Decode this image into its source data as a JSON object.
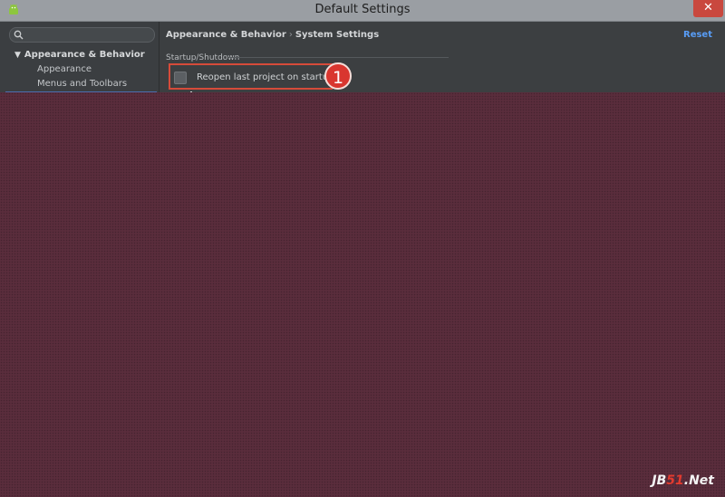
{
  "window": {
    "title": "Default Settings",
    "close_glyph": "✕",
    "app_icon": "android-icon"
  },
  "sidebar": {
    "search_placeholder": "",
    "tree": {
      "parent_label": "Appearance & Behavior",
      "children": [
        "Appearance",
        "Menus and Toolbars"
      ]
    }
  },
  "content": {
    "breadcrumb": {
      "first": "Appearance & Behavior",
      "separator": "›",
      "second": "System Settings"
    },
    "reset_label": "Reset",
    "section_label": "Startup/Shutdown",
    "checkbox": {
      "label": "Reopen last project on startup",
      "checked": false
    }
  },
  "annotation": {
    "number": "1",
    "color": "#d9362f"
  },
  "watermark": {
    "prefix": "JB",
    "number": "51",
    "suffix": ".Net"
  },
  "colors": {
    "accent_link": "#589df6",
    "overlay": "#5a2d3c",
    "callout": "#d64b3a"
  }
}
